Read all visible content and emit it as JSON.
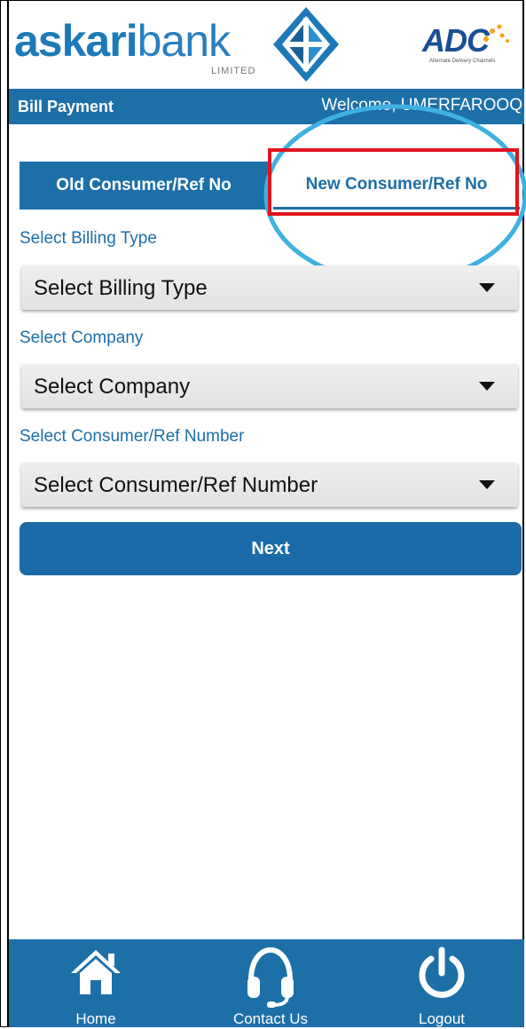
{
  "header": {
    "logo_part1": "askari",
    "logo_part2": "bank",
    "logo_sub": "LIMITED",
    "partner_logo": "ADC",
    "partner_sub": "Alternate Delivery Channels"
  },
  "titlebar": {
    "title": "Bill Payment",
    "welcome": "Welcome, UMERFAROOQ"
  },
  "tabs": [
    {
      "label": "Old Consumer/Ref  No",
      "active": false
    },
    {
      "label": "New Consumer/Ref No",
      "active": true
    }
  ],
  "form": {
    "billing_type_label": "Select Billing Type",
    "billing_type_value": "Select Billing Type",
    "company_label": "Select Company",
    "company_value": "Select Company",
    "consumer_label": "Select Consumer/Ref Number",
    "consumer_value": "Select Consumer/Ref Number",
    "next_label": "Next"
  },
  "nav": {
    "home": "Home",
    "contact": "Contact Us",
    "logout": "Logout"
  },
  "colors": {
    "primary": "#1d6fa8",
    "highlight_rect": "#e0141e",
    "highlight_ellipse": "#3fb1e0"
  },
  "icons": [
    "home-icon",
    "headset-icon",
    "power-icon",
    "dropdown-caret-icon"
  ]
}
